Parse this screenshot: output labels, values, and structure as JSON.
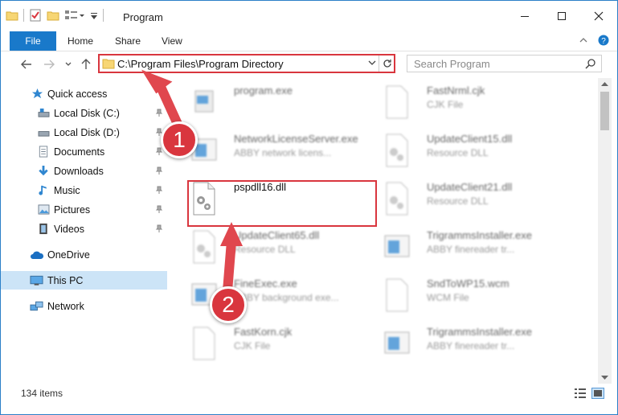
{
  "window": {
    "title": "Program",
    "accent": "#1979ca",
    "highlight": "#d9363e"
  },
  "ribbon": {
    "file": "File",
    "tabs": [
      "Home",
      "Share",
      "View"
    ]
  },
  "address": {
    "path": "C:\\Program Files\\Program Directory"
  },
  "search": {
    "placeholder": "Search Program"
  },
  "sidebar": {
    "items": [
      {
        "label": "Quick access",
        "icon": "star-icon"
      },
      {
        "label": "Local Disk (C:)",
        "icon": "drive-icon"
      },
      {
        "label": "Local Disk (D:)",
        "icon": "drive-icon"
      },
      {
        "label": "Documents",
        "icon": "documents-icon"
      },
      {
        "label": "Downloads",
        "icon": "download-icon"
      },
      {
        "label": "Music",
        "icon": "music-icon"
      },
      {
        "label": "Pictures",
        "icon": "pictures-icon"
      },
      {
        "label": "Videos",
        "icon": "videos-icon"
      },
      {
        "label": "OneDrive",
        "icon": "cloud-icon"
      },
      {
        "label": "This PC",
        "icon": "computer-icon"
      },
      {
        "label": "Network",
        "icon": "network-icon"
      }
    ]
  },
  "files": [
    {
      "name": "program.exe",
      "desc": ""
    },
    {
      "name": "FastNrml.cjk",
      "desc": "CJK File"
    },
    {
      "name": "NetworkLicenseServer.exe",
      "desc": "ABBY network licens..."
    },
    {
      "name": "UpdateClient15.dll",
      "desc": "Resource DLL"
    },
    {
      "name": "pspdll16.dll",
      "desc": ""
    },
    {
      "name": "UpdateClient21.dll",
      "desc": "Resource DLL"
    },
    {
      "name": "UpdateClient65.dll",
      "desc": "Resource DLL"
    },
    {
      "name": "TrigrammsInstaller.exe",
      "desc": "ABBY finereader tr..."
    },
    {
      "name": "FineExec.exe",
      "desc": "ABBY background exe..."
    },
    {
      "name": "SndToWP15.wcm",
      "desc": "WCM File"
    },
    {
      "name": "FastKorn.cjk",
      "desc": "CJK File"
    },
    {
      "name": "TrigrammsInstaller.exe",
      "desc": "ABBY finereader tr..."
    }
  ],
  "status": {
    "count": "134 items"
  },
  "steps": [
    "1",
    "2"
  ]
}
